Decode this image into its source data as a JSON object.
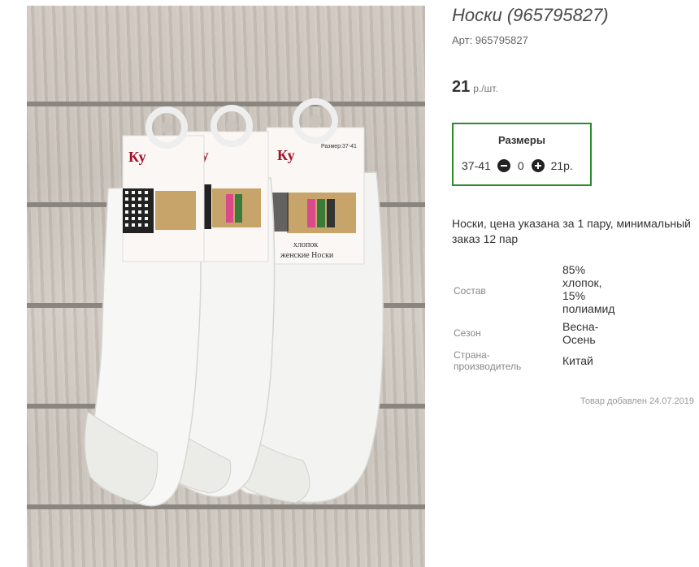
{
  "product": {
    "title": "Носки (965795827)",
    "article": "Арт: 965795827",
    "price_value": "21",
    "price_unit": "р./шт.",
    "image_alt": "Носки белые женские",
    "image_label_brand": "Ку",
    "image_label_text1": "хлопок",
    "image_label_text2": "женские Носки",
    "image_label_size": "Размер:37-41"
  },
  "sizes": {
    "title": "Размеры",
    "rows": [
      {
        "size": "37-41",
        "qty": "0",
        "price": "21р."
      }
    ]
  },
  "description": "Носки, цена указана за 1 пару, минимальный заказ 12 пар",
  "properties": [
    {
      "key": "Состав",
      "value": "85% хлопок, 15% полиамид"
    },
    {
      "key": "Сезон",
      "value": "Весна-Осень"
    },
    {
      "key": "Страна-производитель",
      "value": "Китай"
    }
  ],
  "added_text": "Товар добавлен 24.07.2019"
}
